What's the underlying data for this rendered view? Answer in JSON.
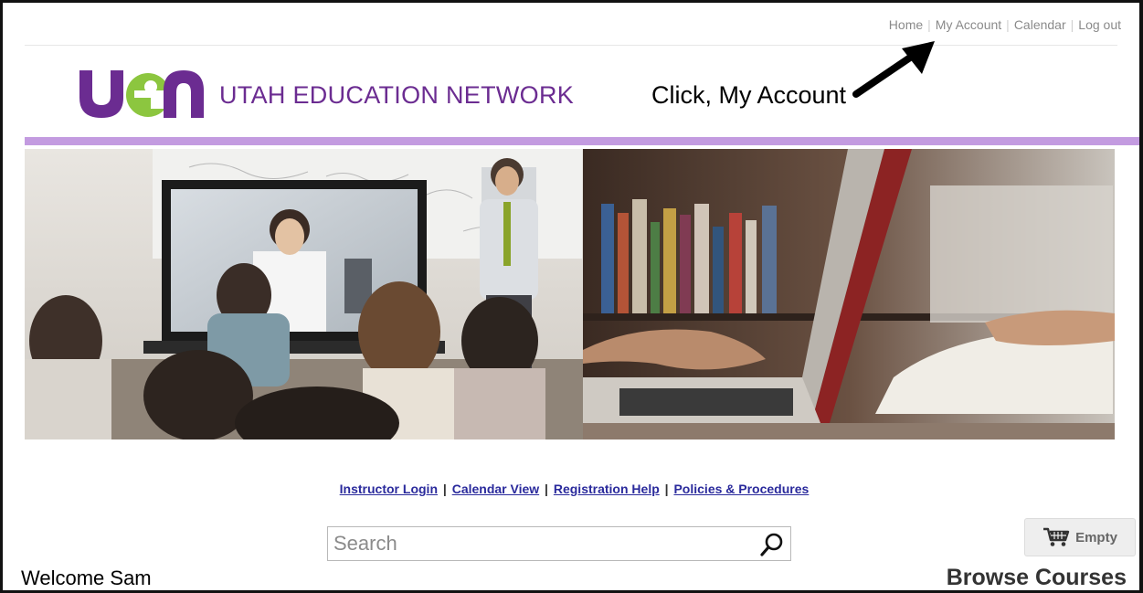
{
  "topnav": {
    "items": [
      "Home",
      "My Account",
      "Calendar",
      "Log out"
    ]
  },
  "brand": {
    "logo_text": "uen",
    "title": "UTAH EDUCATION NETWORK"
  },
  "annotation": {
    "text": "Click, My Account"
  },
  "links": {
    "instructor_login": "Instructor Login",
    "calendar_view": "Calendar View",
    "registration_help": "Registration Help",
    "policies": "Policies & Procedures",
    "separator": "|"
  },
  "search": {
    "placeholder": "Search",
    "icon": "magnifier-icon"
  },
  "cart": {
    "label": "Empty",
    "icon": "shopping-cart-icon"
  },
  "welcome": "Welcome Sam",
  "browse_heading": "Browse Courses",
  "colors": {
    "brand_purple": "#6b2c91",
    "accent_green": "#8cc63f",
    "bar_lavender": "#c39be0",
    "link_blue": "#2a2a9c"
  }
}
